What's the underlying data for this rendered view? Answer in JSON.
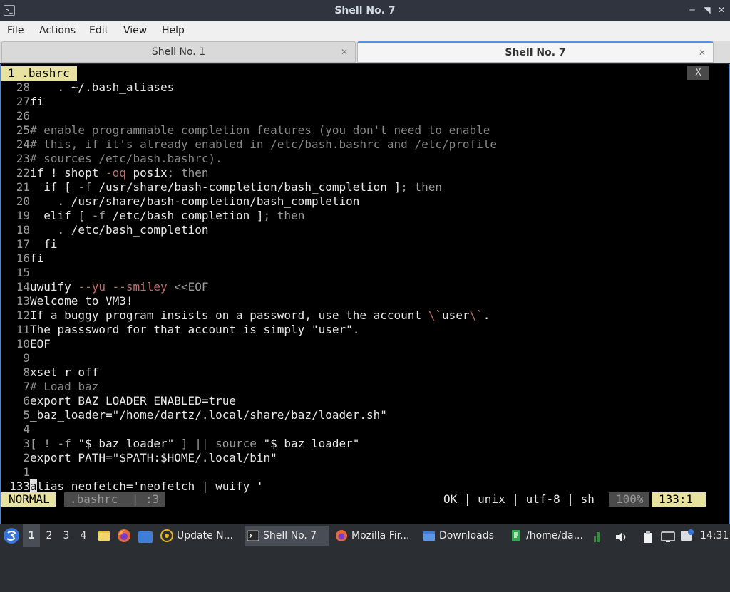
{
  "window": {
    "title": "Shell No. 7"
  },
  "menu": [
    "File",
    "Actions",
    "Edit",
    "View",
    "Help"
  ],
  "tabs": [
    {
      "label": "Shell No. 1"
    },
    {
      "label": "Shell No. 7"
    }
  ],
  "editor": {
    "buffer_tab": "1 .bashrc",
    "buffer_close": "X",
    "lines": [
      {
        "num": "28",
        "segs": [
          {
            "t": "    . ~/.bash_aliases"
          }
        ]
      },
      {
        "num": "27",
        "segs": [
          {
            "t": "fi"
          }
        ]
      },
      {
        "num": "26",
        "segs": []
      },
      {
        "num": "25",
        "segs": [
          {
            "t": "# enable programmable completion features (you don't need to enable",
            "c": "cm"
          }
        ]
      },
      {
        "num": "24",
        "segs": [
          {
            "t": "# this, if it's already enabled in /etc/bash.bashrc and /etc/profile",
            "c": "cm"
          }
        ]
      },
      {
        "num": "23",
        "segs": [
          {
            "t": "# sources /etc/bash.bashrc).",
            "c": "cm"
          }
        ]
      },
      {
        "num": "22",
        "segs": [
          {
            "t": "if ! shopt "
          },
          {
            "t": "-oq",
            "c": "fl"
          },
          {
            "t": " posix"
          },
          {
            "t": "; then",
            "c": "op"
          }
        ]
      },
      {
        "num": "21",
        "segs": [
          {
            "t": "  if [ "
          },
          {
            "t": "-f",
            "c": "op"
          },
          {
            "t": " /usr/share/bash-completion/bash_completion ]"
          },
          {
            "t": "; then",
            "c": "op"
          }
        ]
      },
      {
        "num": "20",
        "segs": [
          {
            "t": "    . /usr/share/bash-completion/bash_completion"
          }
        ]
      },
      {
        "num": "19",
        "segs": [
          {
            "t": "  elif [ "
          },
          {
            "t": "-f",
            "c": "op"
          },
          {
            "t": " /etc/bash_completion ]"
          },
          {
            "t": "; then",
            "c": "op"
          }
        ]
      },
      {
        "num": "18",
        "segs": [
          {
            "t": "    . /etc/bash_completion"
          }
        ]
      },
      {
        "num": "17",
        "segs": [
          {
            "t": "  fi"
          }
        ]
      },
      {
        "num": "16",
        "segs": [
          {
            "t": "fi"
          }
        ]
      },
      {
        "num": "15",
        "segs": []
      },
      {
        "num": "14",
        "segs": [
          {
            "t": "uwuify "
          },
          {
            "t": "--yu --smiley",
            "c": "fl"
          },
          {
            "t": " <<EOF",
            "c": "op"
          }
        ]
      },
      {
        "num": "13",
        "segs": [
          {
            "t": "Welcome to VM3!"
          }
        ]
      },
      {
        "num": "12",
        "segs": [
          {
            "t": "If a buggy program insists on a password, use the account "
          },
          {
            "t": "\\`",
            "c": "fl"
          },
          {
            "t": "user"
          },
          {
            "t": "\\`",
            "c": "fl"
          },
          {
            "t": "."
          }
        ]
      },
      {
        "num": "11",
        "segs": [
          {
            "t": "The passsword for that account is simply \"user\"."
          }
        ]
      },
      {
        "num": "10",
        "segs": [
          {
            "t": "EOF"
          }
        ]
      },
      {
        "num": "9",
        "segs": []
      },
      {
        "num": "8",
        "segs": [
          {
            "t": "xset r off"
          }
        ]
      },
      {
        "num": "7",
        "segs": [
          {
            "t": "# Load baz",
            "c": "cm"
          }
        ]
      },
      {
        "num": "6",
        "segs": [
          {
            "t": "export BAZ_LOADER_ENABLED=true"
          }
        ]
      },
      {
        "num": "5",
        "segs": [
          {
            "t": "_baz_loader=\"/home/dartz/.local/share/baz/loader.sh\""
          }
        ]
      },
      {
        "num": "4",
        "segs": []
      },
      {
        "num": "3",
        "segs": [
          {
            "t": "[ ! -f ",
            "c": "op"
          },
          {
            "t": "\"$_baz_loader\""
          },
          {
            "t": " ] || source ",
            "c": "op"
          },
          {
            "t": "\"$_baz_loader\""
          }
        ]
      },
      {
        "num": "2",
        "segs": [
          {
            "t": "export PATH=\"$PATH:$HOME/.local/bin\""
          }
        ]
      },
      {
        "num": "1",
        "segs": []
      }
    ],
    "current_line": {
      "num": "133",
      "cursor_char": "a",
      "rest": "lias neofetch='neofetch | wuify '"
    }
  },
  "status": {
    "mode": "NORMAL",
    "file": ".bashrc  | :3",
    "info": "OK | unix | utf-8 | sh",
    "percent": "100%",
    "position": "133:1"
  },
  "taskbar": {
    "workspaces": [
      "1",
      "2",
      "3",
      "4"
    ],
    "tasks": [
      {
        "label": "Update N...",
        "icon": "update-icon"
      },
      {
        "label": "Shell No. 7",
        "icon": "terminal-icon"
      },
      {
        "label": "Mozilla Fir...",
        "icon": "firefox-icon"
      },
      {
        "label": "Downloads",
        "icon": "folder-icon"
      },
      {
        "label": "/home/da...",
        "icon": "text-editor-icon"
      }
    ],
    "clock": "14:31"
  },
  "colors": {
    "accent": "#5294e2",
    "vim_yellow": "#e8e2a0",
    "terminal_bg": "#000000"
  }
}
